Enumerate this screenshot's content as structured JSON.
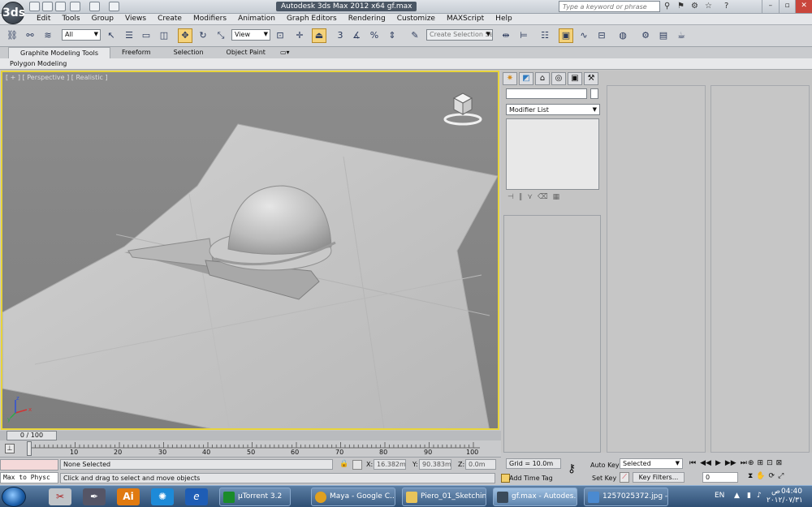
{
  "app": {
    "title": "Autodesk 3ds Max  2012 x64     gf.max",
    "logo": "3ds"
  },
  "search": {
    "placeholder": "Type a keyword or phrase"
  },
  "window_controls": {
    "minimize": "–",
    "restore": "▫",
    "close": "✕"
  },
  "menu": [
    "Edit",
    "Tools",
    "Group",
    "Views",
    "Create",
    "Modifiers",
    "Animation",
    "Graph Editors",
    "Rendering",
    "Customize",
    "MAXScript",
    "Help"
  ],
  "toolbar": {
    "filter_value": "All",
    "coord_value": "View",
    "selection_set_placeholder": "Create Selection Se",
    "snap_value": "3"
  },
  "ribbon": {
    "tabs": [
      "Graphite Modeling Tools",
      "Freeform",
      "Selection",
      "Object Paint"
    ],
    "panel_label": "Polygon Modeling"
  },
  "viewport": {
    "label": "[ + ] [ Perspective ] [ Realistic ]",
    "axis_labels": {
      "x": "x",
      "y": "y",
      "z": "z"
    }
  },
  "command_panel": {
    "modifier_list": "Modifier List"
  },
  "time": {
    "slider_label": "0 / 100",
    "ticks": [
      "10",
      "20",
      "30",
      "40",
      "50",
      "60",
      "70",
      "80",
      "90",
      "100"
    ]
  },
  "status": {
    "maxscript_prompt": "Max to Physc",
    "selection": "None Selected",
    "prompt": "Click and drag to select and move objects",
    "x_label": "X:",
    "x_value": "16.382m",
    "y_label": "Y:",
    "y_value": "90.383m",
    "z_label": "Z:",
    "z_value": "0.0m",
    "grid": "Grid = 10.0m",
    "add_time_tag": "Add Time Tag",
    "auto_key": "Auto Key",
    "auto_key_value": "Selected",
    "set_key": "Set Key",
    "key_filters": "Key Filters...",
    "frame_value": "0"
  },
  "taskbar": {
    "buttons": [
      {
        "label": "µTorrent 3.2",
        "color": "#1a8b2a"
      },
      {
        "label": "Maya - Google C...",
        "color": "#e0a020"
      },
      {
        "label": "Piero_01_Sketching",
        "color": "#e8c45a"
      },
      {
        "label": "gf.max - Autodes...",
        "color": "#3a4a5a"
      },
      {
        "label": "1257025372.jpg - ...",
        "color": "#4b8ad0"
      }
    ],
    "lang": "EN",
    "time": "04:40",
    "ampm": "ص",
    "date": "٢٠١٢/٠٧/٣١"
  }
}
